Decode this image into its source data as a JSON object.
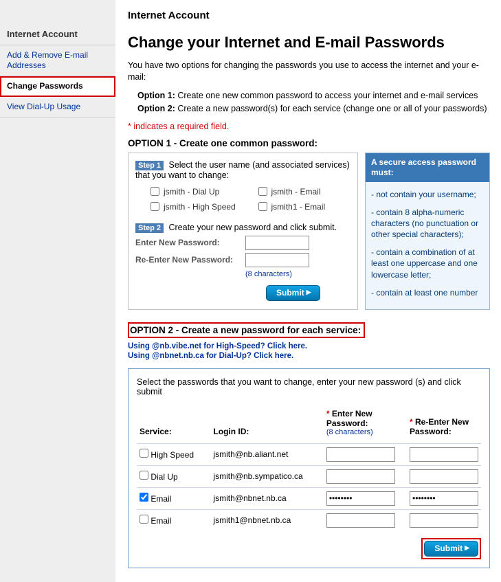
{
  "sidebar": {
    "heading": "Internet Account",
    "items": [
      {
        "label": "Add & Remove E-mail Addresses"
      },
      {
        "label": "Change Passwords"
      },
      {
        "label": "View Dial-Up Usage"
      }
    ]
  },
  "header": {
    "breadcrumb": "Internet Account",
    "title": "Change your Internet and E-mail Passwords"
  },
  "intro": {
    "desc": "You have two options for changing the passwords you use to access the internet and your e-mail:",
    "option1_label": "Option 1:",
    "option1_text": " Create one new common password to access your internet and e-mail services",
    "option2_label": "Option 2:",
    "option2_text": " Create a new password(s) for each service (change one or all of your passwords)",
    "required_note": "* indicates a required field."
  },
  "option1": {
    "heading": "OPTION 1 - Create one common password:",
    "step1_badge": "Step 1",
    "step1_text": " Select the user name (and associated services) that you want to change:",
    "services": [
      {
        "label": "jsmith  - Dial Up"
      },
      {
        "label": "jsmith  - Email"
      },
      {
        "label": "jsmith  - High Speed"
      },
      {
        "label": "jsmith1 - Email"
      }
    ],
    "step2_badge": "Step 2",
    "step2_text": " Create your new password and click submit.",
    "enter_label": "Enter New Password:",
    "reenter_label": "Re-Enter New Password:",
    "chars_note": "(8 characters)",
    "submit_label": "Submit"
  },
  "rules_box": {
    "heading": "A secure access password must:",
    "items": [
      "- not contain your username;",
      "- contain 8 alpha-numeric characters (no punctuation or other special characters);",
      "- contain a combination of at least one uppercase and one lowercase letter;",
      "- contain at least one number"
    ]
  },
  "option2": {
    "heading": "OPTION 2 - Create a new password for each service:",
    "link1": "Using @nb.vibe.net for High-Speed? Click here.",
    "link2": "Using @nbnet.nb.ca for Dial-Up? Click here.",
    "instruction": "Select the passwords that you want to change, enter your new password (s) and click submit",
    "col_service": "Service:",
    "col_login": "Login ID:",
    "col_new": "Enter New Password:",
    "col_new_sub": "(8 characters)",
    "col_re": "Re-Enter New Password:",
    "rows": [
      {
        "service": "High Speed",
        "login": "jsmith@nb.aliant.net",
        "checked": false,
        "pw": ""
      },
      {
        "service": "Dial Up",
        "login": "jsmith@nb.sympatico.ca",
        "checked": false,
        "pw": ""
      },
      {
        "service": "Email",
        "login": "jsmith@nbnet.nb.ca",
        "checked": true,
        "pw": "••••••••"
      },
      {
        "service": "Email",
        "login": "jsmith1@nbnet.nb.ca",
        "checked": false,
        "pw": ""
      }
    ],
    "submit_label": "Submit"
  }
}
